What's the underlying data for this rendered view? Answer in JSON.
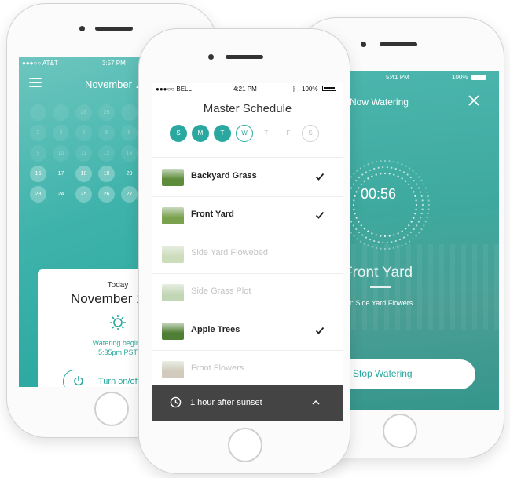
{
  "left_phone": {
    "status": {
      "carrier": "●●●○○ AT&T",
      "time": "3:57 PM"
    },
    "month": "November",
    "calendar_rows": [
      [
        "",
        "",
        "28",
        "29",
        ""
      ],
      [
        "2",
        "3",
        "4",
        "5",
        "6"
      ],
      [
        "9",
        "10",
        "11",
        "12",
        "13"
      ],
      [
        "16",
        "17",
        "18",
        "19",
        "20"
      ],
      [
        "23",
        "24",
        "25",
        "26",
        "27"
      ]
    ],
    "today_label": "Today",
    "today_date": "November 1",
    "watering_begins": "Watering begins",
    "watering_time": "5:35pm PST",
    "turn_button": "Turn on/off"
  },
  "center_phone": {
    "status": {
      "carrier": "●●●○○ BELL",
      "time": "4:21 PM",
      "battery": "100%"
    },
    "title": "Master Schedule",
    "days": [
      {
        "label": "S",
        "state": "filled"
      },
      {
        "label": "M",
        "state": "filled"
      },
      {
        "label": "T",
        "state": "filled"
      },
      {
        "label": "W",
        "state": "outline"
      },
      {
        "label": "T",
        "state": "plain"
      },
      {
        "label": "F",
        "state": "plain"
      },
      {
        "label": "S",
        "state": "outline-grey"
      }
    ],
    "zones": [
      {
        "name": "Backyard Grass",
        "enabled": true
      },
      {
        "name": "Front Yard",
        "enabled": true
      },
      {
        "name": "Side Yard Flowebed",
        "enabled": false
      },
      {
        "name": "Side Grass Plot",
        "enabled": false
      },
      {
        "name": "Apple Trees",
        "enabled": true
      },
      {
        "name": "Front Flowers",
        "enabled": false
      }
    ],
    "footer": "1 hour after sunset"
  },
  "right_phone": {
    "status": {
      "time": "5:41 PM",
      "battery": "100%"
    },
    "title": "Now Watering",
    "timer": "00:56",
    "zone": "Front Yard",
    "up_next": "p next: Side Yard Flowers",
    "stop_button": "Stop Watering"
  },
  "colors": {
    "accent": "#2aa89f",
    "footer": "#444444"
  }
}
